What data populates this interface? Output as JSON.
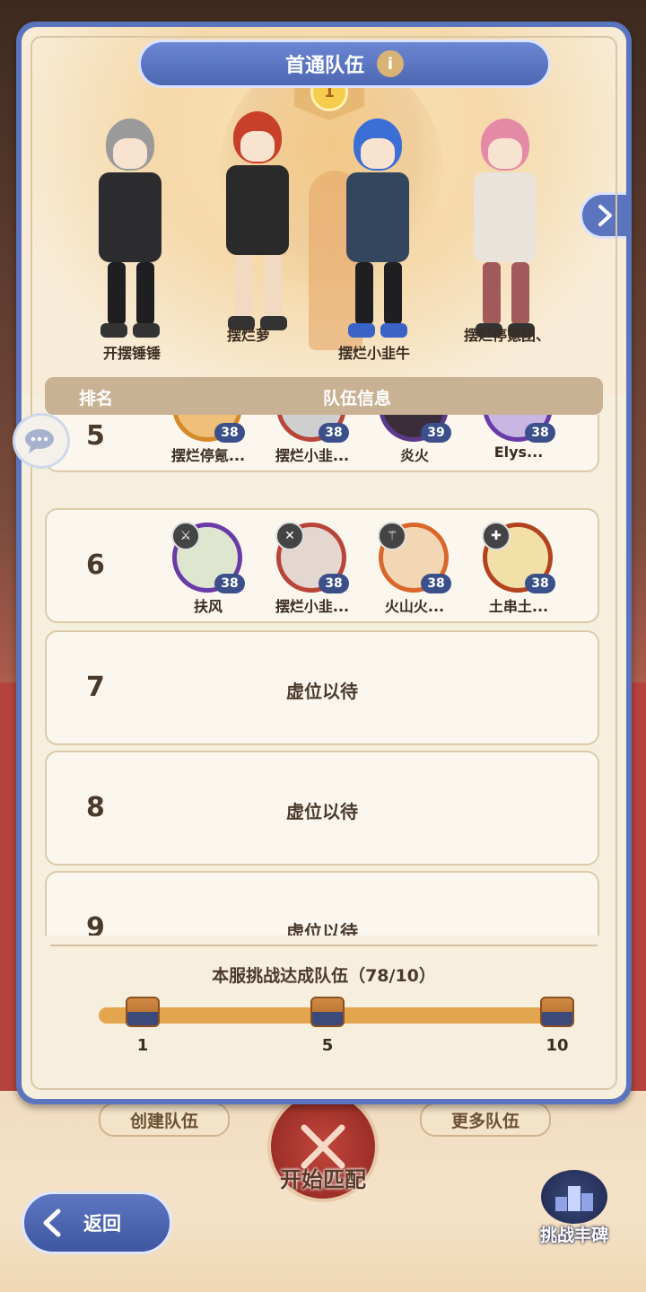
{
  "panel": {
    "title": "首通队伍",
    "info_icon": "i",
    "rank_medal": "1"
  },
  "characters": [
    {
      "name": "开摆锤锤",
      "hair": "#9a9a9a",
      "outfit": "#2c2c2e"
    },
    {
      "name": "摆烂萝",
      "hair": "#c8402a",
      "outfit": "#2a2a2a"
    },
    {
      "name": "摆烂小韭牛",
      "hair": "#3c6fd6",
      "outfit": "#34465e"
    },
    {
      "name": "摆烂停氪团、",
      "hair": "#e58aa6",
      "outfit": "#e9e3dc"
    }
  ],
  "table": {
    "col_rank": "排名",
    "col_info": "队伍信息",
    "rows": [
      {
        "rank": "5",
        "members": [
          {
            "name": "摆烂停氪...",
            "level": "38",
            "role": "✦"
          },
          {
            "name": "摆烂小韭...",
            "level": "38",
            "role": "✕"
          },
          {
            "name": "炎火",
            "level": "39",
            "role": "✦"
          },
          {
            "name": "Elys...",
            "level": "38",
            "role": "✦"
          }
        ]
      },
      {
        "rank": "6",
        "members": [
          {
            "name": "扶风",
            "level": "38",
            "role": "⚔"
          },
          {
            "name": "摆烂小韭...",
            "level": "38",
            "role": "✕"
          },
          {
            "name": "火山火...",
            "level": "38",
            "role": "⚚"
          },
          {
            "name": "土串土...",
            "level": "38",
            "role": "✚"
          }
        ]
      },
      {
        "rank": "7",
        "empty": "虚位以待"
      },
      {
        "rank": "8",
        "empty": "虚位以待"
      },
      {
        "rank": "9",
        "empty": "虚位以待"
      }
    ]
  },
  "progress": {
    "title": "本服挑战达成队伍（78/10）",
    "milestones": [
      "1",
      "5",
      "10"
    ],
    "fraction": 1.0
  },
  "bottom": {
    "create_team": "创建队伍",
    "more_teams": "更多队伍",
    "start_match": "开始匹配",
    "trophy_label": "挑战丰碑",
    "back_label": "返回"
  },
  "colors": {
    "panel_blue": "#5a74bd",
    "accent_orange": "#e3a64f",
    "level_badge": "#3b4f8a"
  }
}
